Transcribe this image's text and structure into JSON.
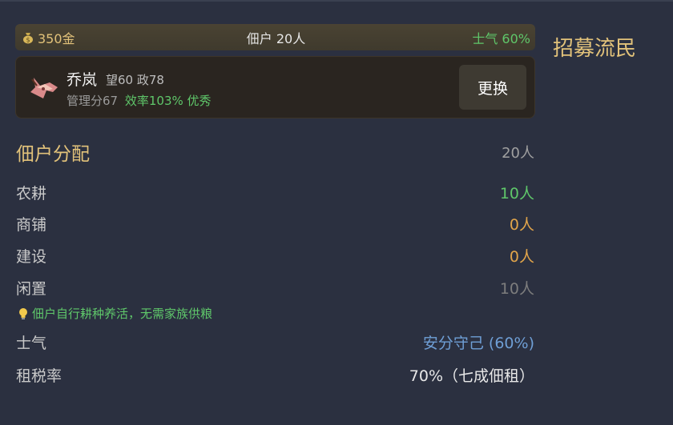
{
  "stats": {
    "gold": "350金",
    "tenants": "佃户 20人",
    "morale": "士气 60%"
  },
  "manager": {
    "name": "乔岚",
    "attrs": "望60 政78",
    "score": "管理分67",
    "efficiency": "效率103% 优秀",
    "swap_label": "更换"
  },
  "side": {
    "recruit_title": "招募流民"
  },
  "allocation": {
    "title": "佃户分配",
    "total": "20人",
    "rows": [
      {
        "label": "农耕",
        "value": "10人",
        "color": "#5fc76a"
      },
      {
        "label": "商铺",
        "value": "0人",
        "color": "#e2a54a"
      },
      {
        "label": "建设",
        "value": "0人",
        "color": "#e2a54a"
      },
      {
        "label": "闲置",
        "value": "10人",
        "color": "#7d7d7d"
      }
    ],
    "hint": "佃户自行耕种养活，无需家族供粮",
    "morale_label": "士气",
    "morale_value": "安分守己 (60%)",
    "tax_label": "租税率",
    "tax_value": "70%（七成佃租）"
  },
  "icons": [
    "moneybag-icon",
    "lightbulb-icon",
    "manager-portrait"
  ]
}
